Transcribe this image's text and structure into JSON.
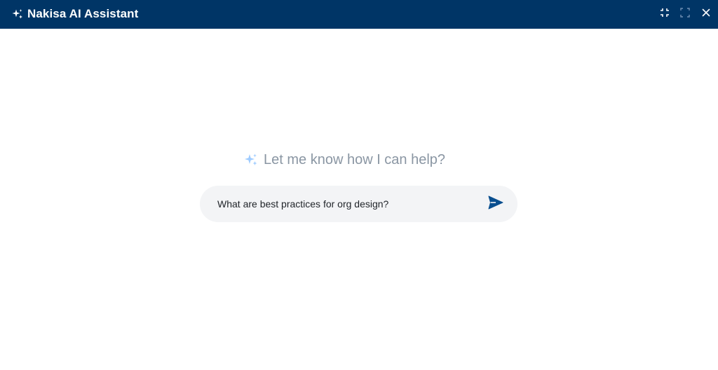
{
  "window": {
    "title": "Nakisa AI Assistant",
    "title_icon": "sparkle-icon",
    "controls": {
      "minimize_icon": "collapse-icon",
      "maximize_icon": "expand-icon",
      "close_icon": "close-icon"
    }
  },
  "main": {
    "prompt_icon": "sparkle-icon",
    "prompt_text": "Let me know how I can help?",
    "input": {
      "value": "What are best practices for org design?",
      "placeholder": ""
    },
    "send_icon": "send-icon"
  },
  "colors": {
    "titlebar": "#003566",
    "accent": "#0a4f8f",
    "prompt_text": "#8a96a3",
    "input_bg": "#f3f4f6",
    "sparkle_light": "#9ecbff"
  }
}
